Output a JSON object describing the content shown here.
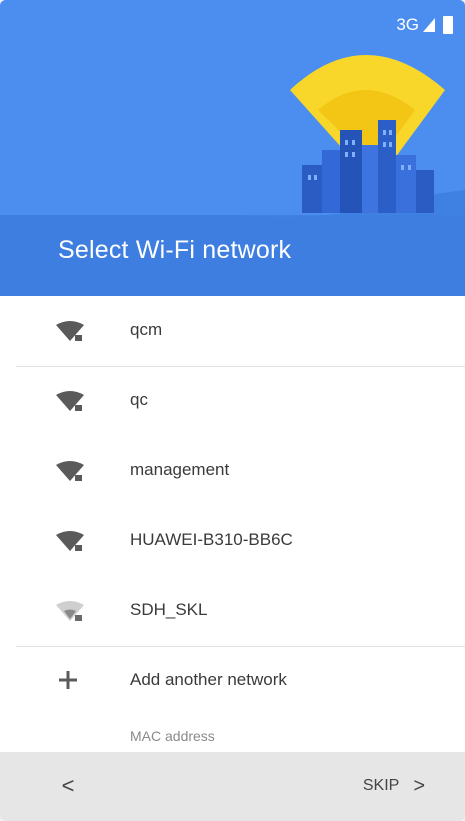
{
  "status_bar": {
    "network_type": "3G",
    "signal_icon": "signal-icon",
    "battery_icon": "battery-icon"
  },
  "header": {
    "title": "Select Wi-Fi network",
    "illustration": "wifi-city-illustration",
    "background_color": "#4c8ef0",
    "accent_color": "#f8d72a"
  },
  "networks": [
    {
      "ssid": "qcm",
      "icon": "wifi-locked-icon",
      "signal_level": 3
    },
    {
      "ssid": "qc",
      "icon": "wifi-locked-icon",
      "signal_level": 3
    },
    {
      "ssid": "management",
      "icon": "wifi-locked-icon",
      "signal_level": 3
    },
    {
      "ssid": "HUAWEI-B310-BB6C",
      "icon": "wifi-locked-icon",
      "signal_level": 3
    },
    {
      "ssid": "SDH_SKL",
      "icon": "wifi-locked-icon",
      "signal_level": 1
    }
  ],
  "add_network": {
    "label": "Add another network",
    "icon": "plus-icon"
  },
  "mac_address_label": "MAC address",
  "bottom_bar": {
    "back_label": "<",
    "skip_label": "SKIP",
    "skip_chevron": ">"
  }
}
